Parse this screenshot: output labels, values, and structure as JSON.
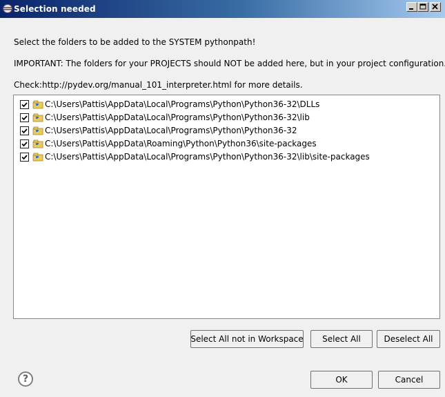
{
  "window": {
    "title": "Selection needed"
  },
  "messages": {
    "line1": "Select the folders to be added to the SYSTEM pythonpath!",
    "line2": "IMPORTANT: The folders for your PROJECTS should NOT be added here, but in your project configuration.",
    "line3": "Check:http://pydev.org/manual_101_interpreter.html for more details."
  },
  "folders": [
    {
      "checked": true,
      "path": "C:\\Users\\Pattis\\AppData\\Local\\Programs\\Python\\Python36-32\\DLLs"
    },
    {
      "checked": true,
      "path": "C:\\Users\\Pattis\\AppData\\Local\\Programs\\Python\\Python36-32\\lib"
    },
    {
      "checked": true,
      "path": "C:\\Users\\Pattis\\AppData\\Local\\Programs\\Python\\Python36-32"
    },
    {
      "checked": true,
      "path": "C:\\Users\\Pattis\\AppData\\Roaming\\Python\\Python36\\site-packages"
    },
    {
      "checked": true,
      "path": "C:\\Users\\Pattis\\AppData\\Local\\Programs\\Python\\Python36-32\\lib\\site-packages"
    }
  ],
  "buttons": {
    "select_not_in_workspace": "Select All not in Workspace",
    "select_all": "Select All",
    "deselect_all": "Deselect All",
    "ok": "OK",
    "cancel": "Cancel",
    "help": "?"
  }
}
